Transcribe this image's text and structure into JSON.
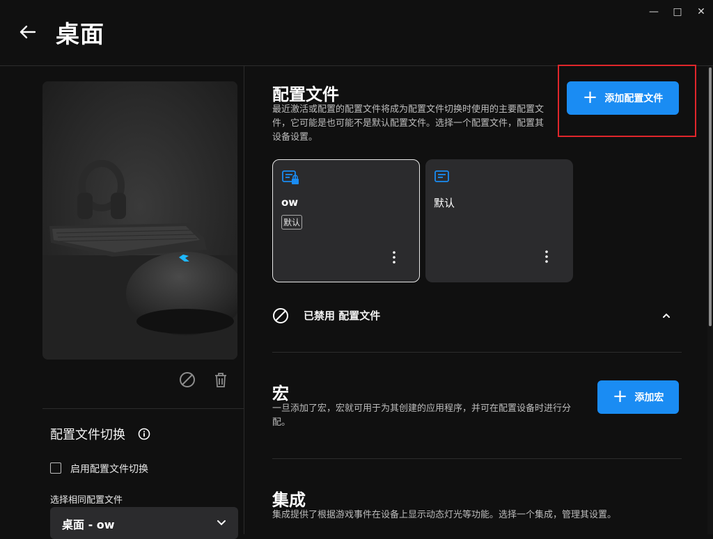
{
  "header": {
    "title": "桌面"
  },
  "left": {
    "profile_switch_title": "配置文件切换",
    "enable_switch_label": "启用配置文件切换",
    "select_same_label": "选择相同配置文件",
    "select_value": "桌面 - ow"
  },
  "profiles": {
    "title": "配置文件",
    "description": "最近激活或配置的配置文件将成为配置文件切换时使用的主要配置文件，它可能是也可能不是默认配置文件。选择一个配置文件，配置其设备设置。",
    "add_button": "添加配置文件",
    "cards": [
      {
        "name": "ow",
        "badge": "默认",
        "icon": "profile-locked-icon"
      },
      {
        "name": "默认",
        "icon": "profile-icon"
      }
    ],
    "disabled_label": "已禁用 配置文件"
  },
  "macros": {
    "title": "宏",
    "description": "一旦添加了宏，宏就可用于为其创建的应用程序，并可在配置设备时进行分配。",
    "add_button": "添加宏"
  },
  "integrations": {
    "title": "集成",
    "description": "集成提供了根据游戏事件在设备上显示动态灯光等功能。选择一个集成，管理其设置。"
  },
  "colors": {
    "accent": "#1a8cf3",
    "highlight": "#e0262b",
    "background": "#101010",
    "card": "#2b2b2d"
  }
}
